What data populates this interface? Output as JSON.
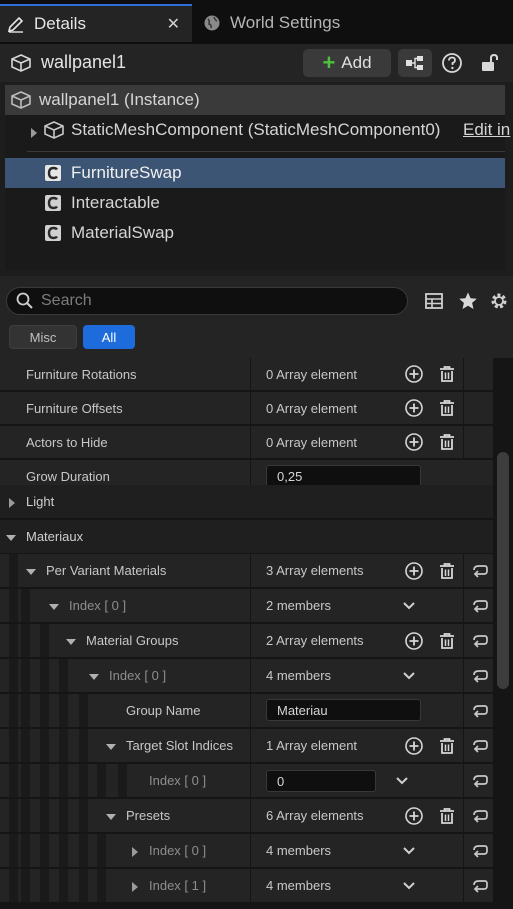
{
  "tabs": [
    {
      "label": "Details",
      "icon": "pencil-icon"
    },
    {
      "label": "World Settings",
      "icon": "globe-icon"
    }
  ],
  "close_glyph": "✕",
  "header": {
    "actor_name": "wallpanel1",
    "add_label": "Add"
  },
  "components": {
    "instance_label": "wallpanel1 (Instance)",
    "static_mesh_label": "StaticMeshComponent (StaticMeshComponent0)",
    "edit_link": "Edit in",
    "items": [
      "FurnitureSwap",
      "Interactable",
      "MaterialSwap"
    ]
  },
  "search": {
    "placeholder": "Search"
  },
  "filters": {
    "misc": "Misc",
    "all": "All"
  },
  "properties": {
    "furniture_rotations": {
      "name": "Furniture Rotations",
      "value": "0 Array element"
    },
    "furniture_offsets": {
      "name": "Furniture Offsets",
      "value": "0 Array element"
    },
    "actors_to_hide": {
      "name": "Actors to Hide",
      "value": "0 Array element"
    },
    "grow_duration": {
      "name": "Grow Duration",
      "value": "0,25"
    },
    "light": {
      "name": "Light"
    },
    "materiaux": {
      "name": "Materiaux"
    },
    "per_variant": {
      "name": "Per Variant Materials",
      "value": "3 Array elements"
    },
    "index0": {
      "name": "Index [ 0 ]",
      "value": "2 members"
    },
    "material_groups": {
      "name": "Material Groups",
      "value": "2 Array elements"
    },
    "group_index0": {
      "name": "Index [ 0 ]",
      "value": "4 members"
    },
    "group_name": {
      "name": "Group Name",
      "value": "Materiau"
    },
    "target_slot": {
      "name": "Target Slot Indices",
      "value": "1 Array element"
    },
    "slot_index0": {
      "name": "Index [ 0 ]",
      "value": "0"
    },
    "presets": {
      "name": "Presets",
      "value": "6 Array elements"
    },
    "preset_index0": {
      "name": "Index [ 0 ]",
      "value": "4 members"
    },
    "preset_index1": {
      "name": "Index [ 1 ]",
      "value": "4 members"
    }
  },
  "colors": {
    "accent": "#1e6cdb",
    "selection": "#3d5575",
    "add_plus": "#50c040"
  }
}
